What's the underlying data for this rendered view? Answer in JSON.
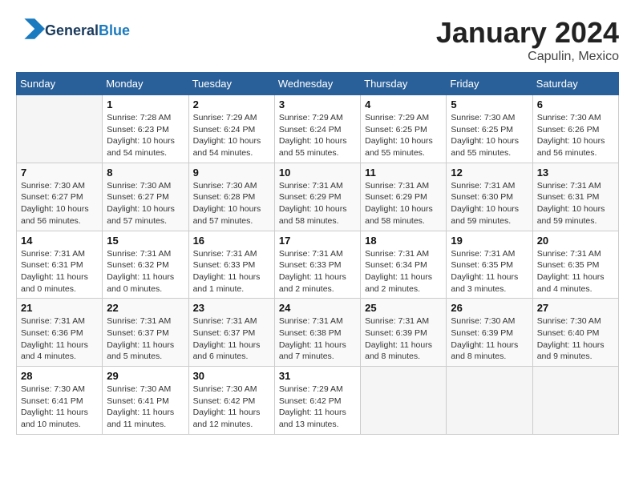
{
  "header": {
    "logo_line1": "General",
    "logo_line2": "Blue",
    "month": "January 2024",
    "location": "Capulin, Mexico"
  },
  "weekdays": [
    "Sunday",
    "Monday",
    "Tuesday",
    "Wednesday",
    "Thursday",
    "Friday",
    "Saturday"
  ],
  "weeks": [
    [
      {
        "day": "",
        "info": ""
      },
      {
        "day": "1",
        "info": "Sunrise: 7:28 AM\nSunset: 6:23 PM\nDaylight: 10 hours\nand 54 minutes."
      },
      {
        "day": "2",
        "info": "Sunrise: 7:29 AM\nSunset: 6:24 PM\nDaylight: 10 hours\nand 54 minutes."
      },
      {
        "day": "3",
        "info": "Sunrise: 7:29 AM\nSunset: 6:24 PM\nDaylight: 10 hours\nand 55 minutes."
      },
      {
        "day": "4",
        "info": "Sunrise: 7:29 AM\nSunset: 6:25 PM\nDaylight: 10 hours\nand 55 minutes."
      },
      {
        "day": "5",
        "info": "Sunrise: 7:30 AM\nSunset: 6:25 PM\nDaylight: 10 hours\nand 55 minutes."
      },
      {
        "day": "6",
        "info": "Sunrise: 7:30 AM\nSunset: 6:26 PM\nDaylight: 10 hours\nand 56 minutes."
      }
    ],
    [
      {
        "day": "7",
        "info": "Sunrise: 7:30 AM\nSunset: 6:27 PM\nDaylight: 10 hours\nand 56 minutes."
      },
      {
        "day": "8",
        "info": "Sunrise: 7:30 AM\nSunset: 6:27 PM\nDaylight: 10 hours\nand 57 minutes."
      },
      {
        "day": "9",
        "info": "Sunrise: 7:30 AM\nSunset: 6:28 PM\nDaylight: 10 hours\nand 57 minutes."
      },
      {
        "day": "10",
        "info": "Sunrise: 7:31 AM\nSunset: 6:29 PM\nDaylight: 10 hours\nand 58 minutes."
      },
      {
        "day": "11",
        "info": "Sunrise: 7:31 AM\nSunset: 6:29 PM\nDaylight: 10 hours\nand 58 minutes."
      },
      {
        "day": "12",
        "info": "Sunrise: 7:31 AM\nSunset: 6:30 PM\nDaylight: 10 hours\nand 59 minutes."
      },
      {
        "day": "13",
        "info": "Sunrise: 7:31 AM\nSunset: 6:31 PM\nDaylight: 10 hours\nand 59 minutes."
      }
    ],
    [
      {
        "day": "14",
        "info": "Sunrise: 7:31 AM\nSunset: 6:31 PM\nDaylight: 11 hours\nand 0 minutes."
      },
      {
        "day": "15",
        "info": "Sunrise: 7:31 AM\nSunset: 6:32 PM\nDaylight: 11 hours\nand 0 minutes."
      },
      {
        "day": "16",
        "info": "Sunrise: 7:31 AM\nSunset: 6:33 PM\nDaylight: 11 hours\nand 1 minute."
      },
      {
        "day": "17",
        "info": "Sunrise: 7:31 AM\nSunset: 6:33 PM\nDaylight: 11 hours\nand 2 minutes."
      },
      {
        "day": "18",
        "info": "Sunrise: 7:31 AM\nSunset: 6:34 PM\nDaylight: 11 hours\nand 2 minutes."
      },
      {
        "day": "19",
        "info": "Sunrise: 7:31 AM\nSunset: 6:35 PM\nDaylight: 11 hours\nand 3 minutes."
      },
      {
        "day": "20",
        "info": "Sunrise: 7:31 AM\nSunset: 6:35 PM\nDaylight: 11 hours\nand 4 minutes."
      }
    ],
    [
      {
        "day": "21",
        "info": "Sunrise: 7:31 AM\nSunset: 6:36 PM\nDaylight: 11 hours\nand 4 minutes."
      },
      {
        "day": "22",
        "info": "Sunrise: 7:31 AM\nSunset: 6:37 PM\nDaylight: 11 hours\nand 5 minutes."
      },
      {
        "day": "23",
        "info": "Sunrise: 7:31 AM\nSunset: 6:37 PM\nDaylight: 11 hours\nand 6 minutes."
      },
      {
        "day": "24",
        "info": "Sunrise: 7:31 AM\nSunset: 6:38 PM\nDaylight: 11 hours\nand 7 minutes."
      },
      {
        "day": "25",
        "info": "Sunrise: 7:31 AM\nSunset: 6:39 PM\nDaylight: 11 hours\nand 8 minutes."
      },
      {
        "day": "26",
        "info": "Sunrise: 7:30 AM\nSunset: 6:39 PM\nDaylight: 11 hours\nand 8 minutes."
      },
      {
        "day": "27",
        "info": "Sunrise: 7:30 AM\nSunset: 6:40 PM\nDaylight: 11 hours\nand 9 minutes."
      }
    ],
    [
      {
        "day": "28",
        "info": "Sunrise: 7:30 AM\nSunset: 6:41 PM\nDaylight: 11 hours\nand 10 minutes."
      },
      {
        "day": "29",
        "info": "Sunrise: 7:30 AM\nSunset: 6:41 PM\nDaylight: 11 hours\nand 11 minutes."
      },
      {
        "day": "30",
        "info": "Sunrise: 7:30 AM\nSunset: 6:42 PM\nDaylight: 11 hours\nand 12 minutes."
      },
      {
        "day": "31",
        "info": "Sunrise: 7:29 AM\nSunset: 6:42 PM\nDaylight: 11 hours\nand 13 minutes."
      },
      {
        "day": "",
        "info": ""
      },
      {
        "day": "",
        "info": ""
      },
      {
        "day": "",
        "info": ""
      }
    ]
  ]
}
